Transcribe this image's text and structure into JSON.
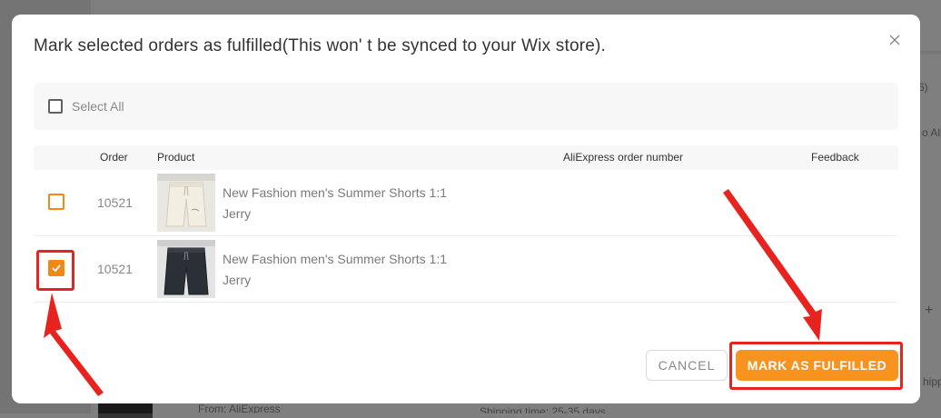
{
  "background": {
    "snippet_1": "6)",
    "snippet_2": "o All",
    "snippet_3": "From: AliExpress",
    "snippet_4": "Shipping time: 25-35 days",
    "snippet_5": "hipp",
    "plus": "+"
  },
  "modal": {
    "title": "Mark selected orders as fulfilled(This won' t be synced to your Wix store).",
    "close_glyph": "×",
    "select_all_label": "Select All",
    "columns": {
      "order": "Order",
      "product": "Product",
      "aliexpress_order": "AliExpress order number",
      "feedback": "Feedback"
    },
    "rows": [
      {
        "order": "10521",
        "title": "New Fashion men's Summer Shorts 1:1",
        "vendor": "Jerry",
        "checked": false,
        "image": "cream-shorts"
      },
      {
        "order": "10521",
        "title": "New Fashion men's Summer Shorts 1:1",
        "vendor": "Jerry",
        "checked": true,
        "image": "black-shorts"
      }
    ],
    "cancel_label": "CANCEL",
    "primary_label": "MARK AS FULFILLED"
  },
  "colors": {
    "accent": "#f7931e",
    "checkbox_orange": "#f0891a",
    "annotation_red": "#e8231f"
  },
  "icons": {
    "close": "close-icon",
    "check": "check-icon"
  }
}
